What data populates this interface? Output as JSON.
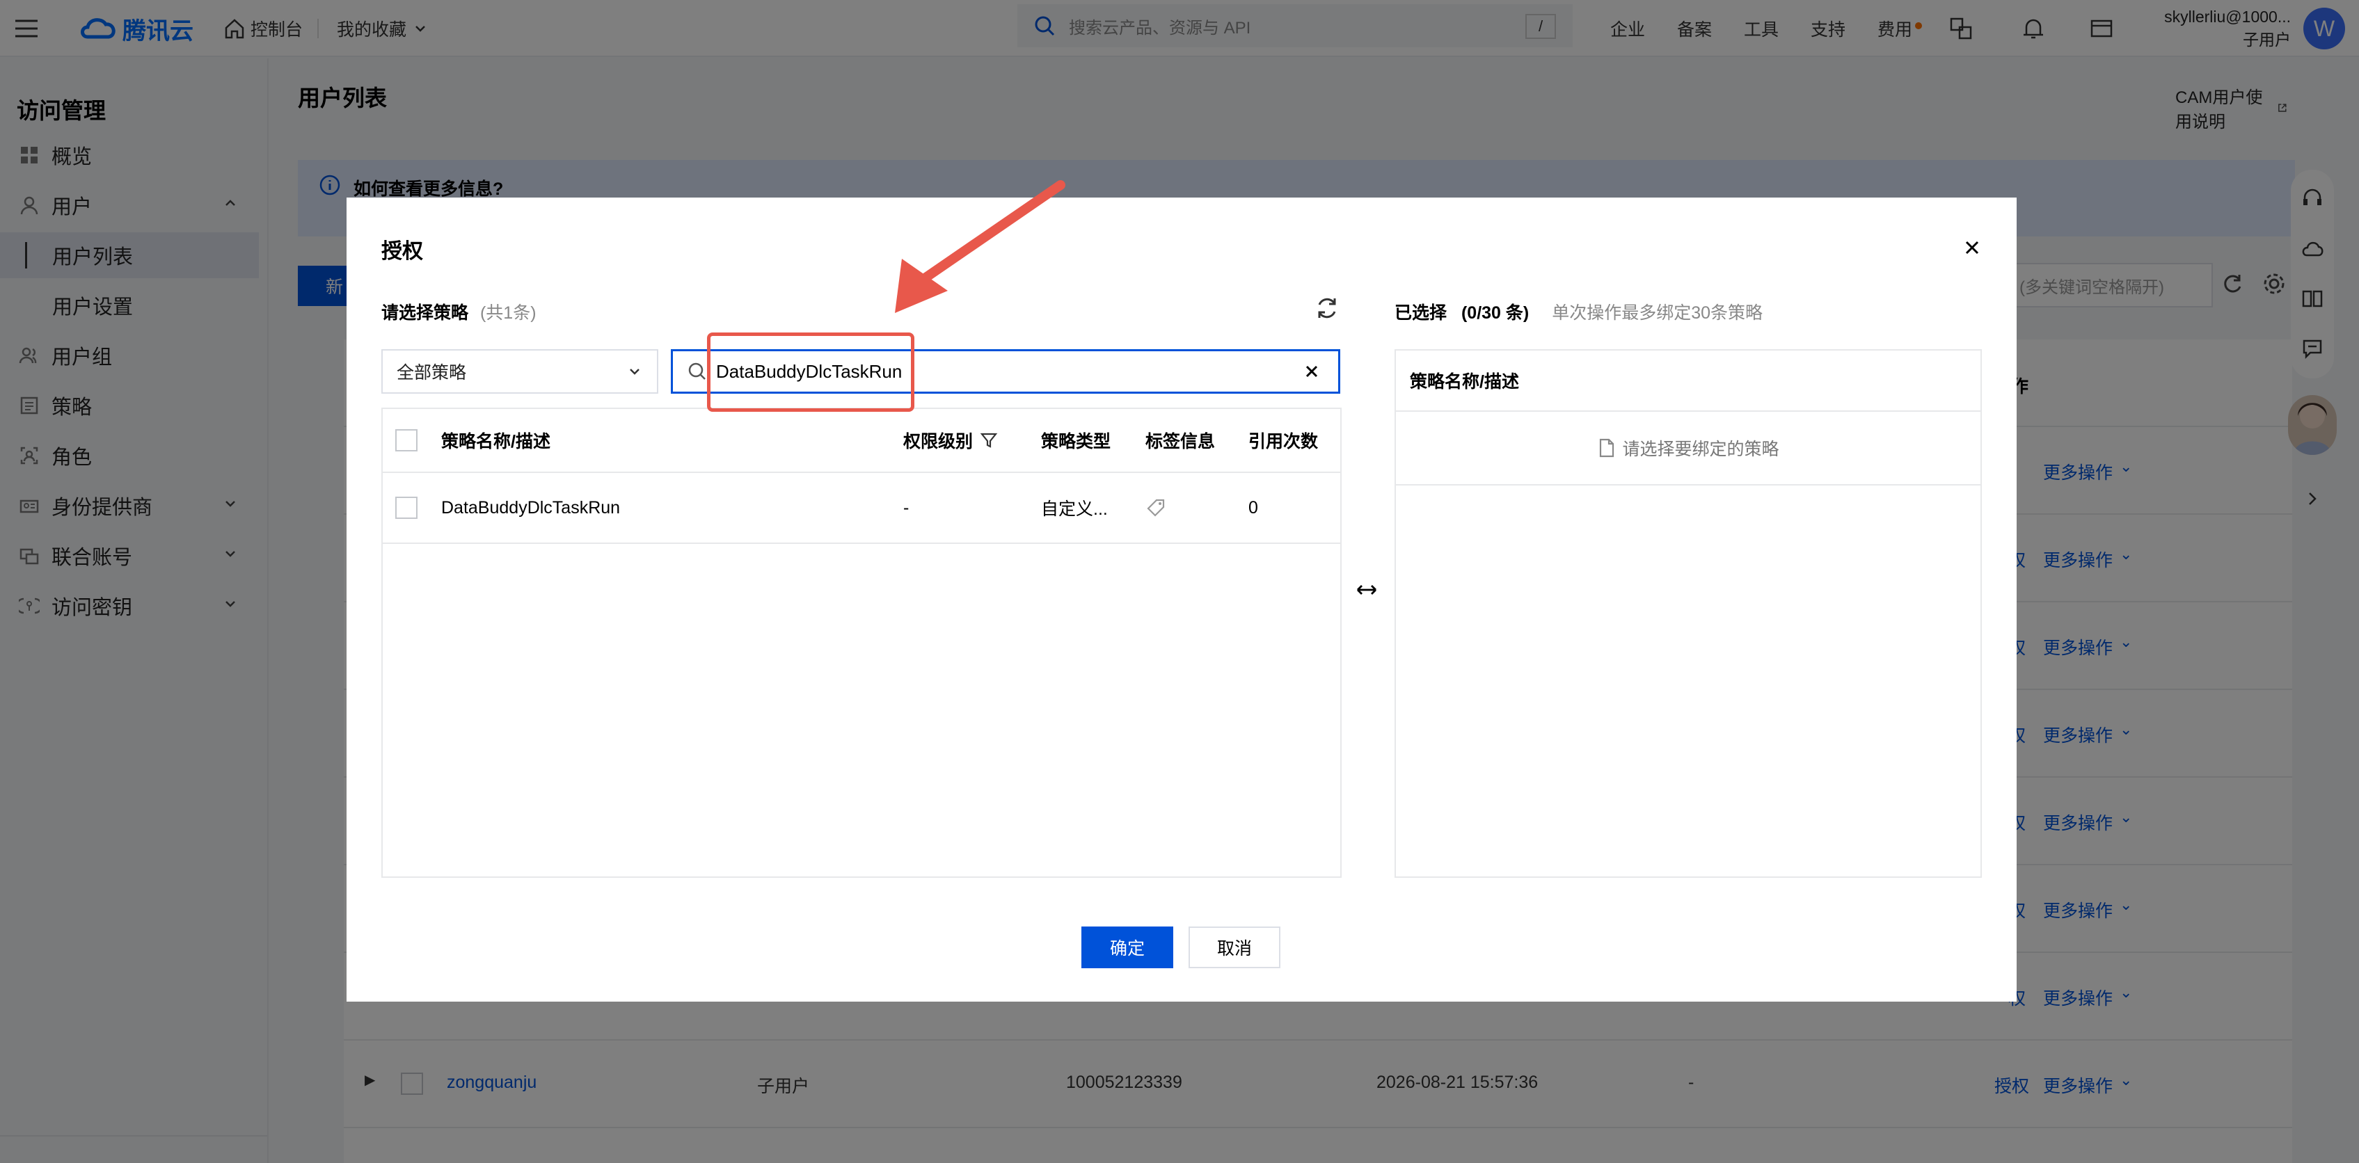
{
  "topbar": {
    "logo": "腾讯云",
    "console": "控制台",
    "favorites": "我的收藏",
    "search_placeholder": "搜索云产品、资源与 API",
    "search_shortcut": "/",
    "links": [
      "企业",
      "备案",
      "工具",
      "支持",
      "费用"
    ],
    "user_name": "skyllerliu@1000...",
    "user_role": "子用户",
    "avatar_letter": "W"
  },
  "sidebar": {
    "title": "访问管理",
    "items": [
      {
        "label": "概览"
      },
      {
        "label": "用户"
      },
      {
        "label": "用户列表"
      },
      {
        "label": "用户设置"
      },
      {
        "label": "用户组"
      },
      {
        "label": "策略"
      },
      {
        "label": "角色"
      },
      {
        "label": "身份提供商"
      },
      {
        "label": "联合账号"
      },
      {
        "label": "访问密钥"
      }
    ]
  },
  "page": {
    "title": "用户列表",
    "help_link": "CAM用户使用说明",
    "info_banner": "如何查看更多信息?",
    "new_button": "新",
    "search_placeholder": "(多关键词空格隔开)",
    "op_header": "作",
    "row_actions": {
      "authorize": "授权",
      "authorize_short": "权",
      "more": "更多操作"
    },
    "visible_row": {
      "name": "zongquanju",
      "type": "子用户",
      "id": "100052123339",
      "time": "2026-08-21 15:57:36",
      "extra": "-"
    }
  },
  "dialog": {
    "title": "授权",
    "left_label": "请选择策略",
    "left_count": "(共1条)",
    "filter_select": "全部策略",
    "search_value": "DataBuddyDlcTaskRun",
    "columns": [
      "策略名称/描述",
      "权限级别",
      "策略类型",
      "标签信息",
      "引用次数"
    ],
    "rows": [
      {
        "name": "DataBuddyDlcTaskRun",
        "level": "-",
        "type": "自定义...",
        "refs": "0"
      }
    ],
    "right_label": "已选择",
    "right_count": "(0/30 条)",
    "right_hint": "单次操作最多绑定30条策略",
    "right_column": "策略名称/描述",
    "right_empty": "请选择要绑定的策略",
    "confirm": "确定",
    "cancel": "取消"
  },
  "colors": {
    "primary": "#0052d9",
    "annotation": "#e8584b",
    "overlay": "rgba(0,0,0,0.5)"
  }
}
